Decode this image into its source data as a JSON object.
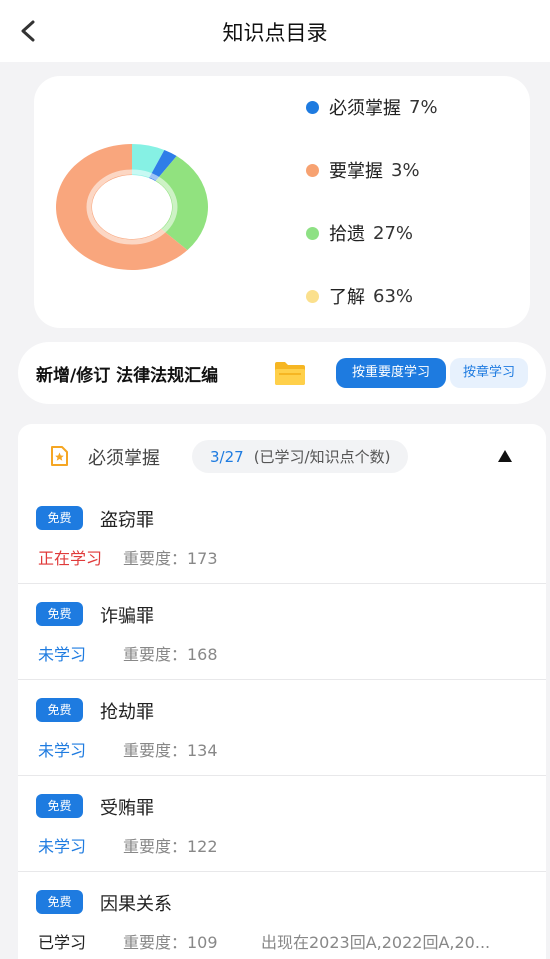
{
  "header": {
    "title": "知识点目录"
  },
  "chart_data": {
    "type": "pie",
    "categories": [
      "必须掌握",
      "要掌握",
      "拾遗",
      "了解"
    ],
    "values": [
      7,
      3,
      27,
      63
    ],
    "value_labels": [
      "7%",
      "3%",
      "27%",
      "63%"
    ],
    "colors": [
      "#1e7be0",
      "#f7a271",
      "#8ee184",
      "#fbe08d"
    ],
    "segment_colors": [
      "#86f1e4",
      "#2f7de8",
      "#91e27f",
      "#f9a67d"
    ],
    "donut": true
  },
  "promo": {
    "text": "新增/修订 法律法规汇编",
    "btn_importance": "按重要度学习",
    "btn_chapter": "按章学习"
  },
  "section": {
    "title": "必须掌握",
    "progress": "3/27",
    "progress_note": "(已学习/知识点个数)"
  },
  "items": [
    {
      "badge": "免费",
      "title": "盗窃罪",
      "status": "正在学习",
      "status_color": "#e03a3a",
      "importance": "重要度：173"
    },
    {
      "badge": "免费",
      "title": "诈骗罪",
      "status": "未学习",
      "status_color": "#1e7be0",
      "importance": "重要度：168"
    },
    {
      "badge": "免费",
      "title": "抢劫罪",
      "status": "未学习",
      "status_color": "#1e7be0",
      "importance": "重要度：134"
    },
    {
      "badge": "免费",
      "title": "受贿罪",
      "status": "未学习",
      "status_color": "#1e7be0",
      "importance": "重要度：122"
    },
    {
      "badge": "免费",
      "title": "因果关系",
      "status": "已学习",
      "status_color": "#222222",
      "importance": "重要度：109",
      "appears": "出现在2023回A,2022回A,20..."
    }
  ]
}
